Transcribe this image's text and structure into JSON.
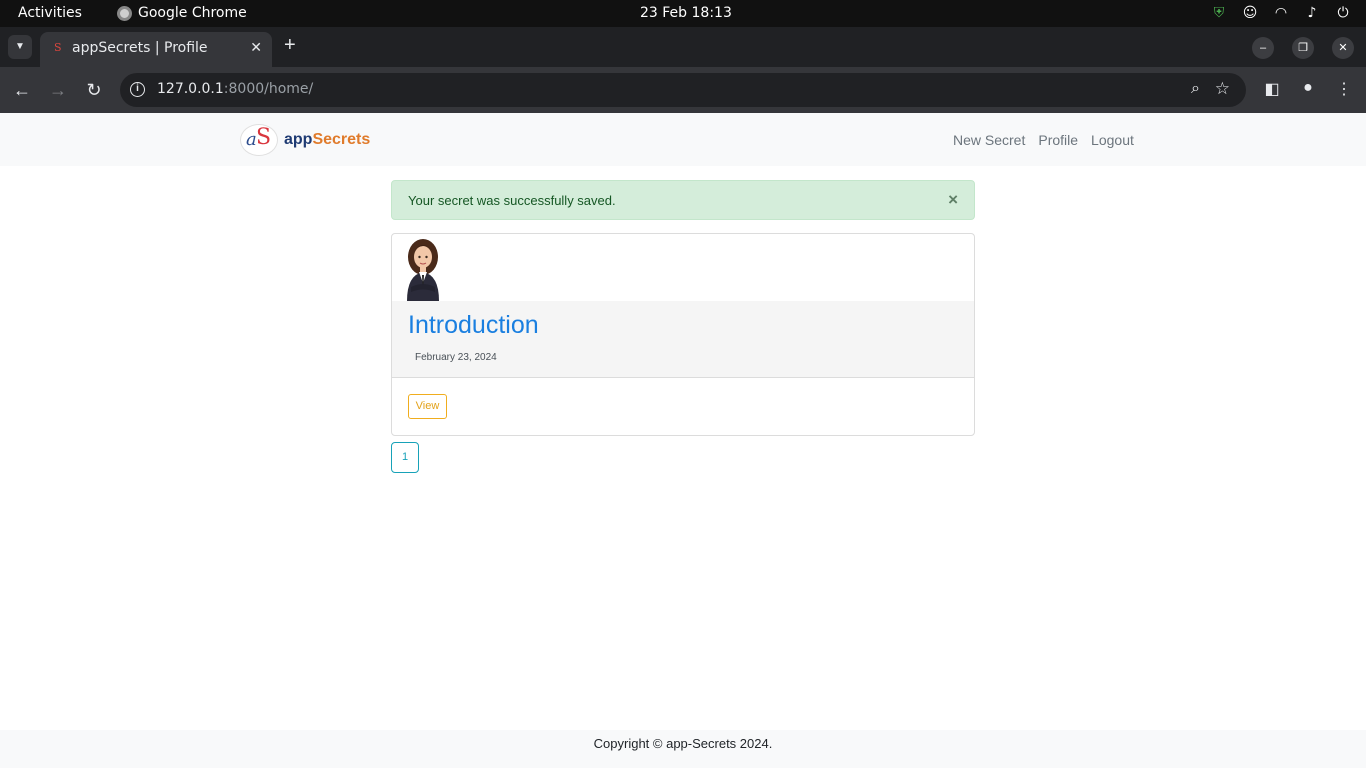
{
  "system_bar": {
    "activities": "Activities",
    "app_name": "Google Chrome",
    "clock": "23 Feb  18:13"
  },
  "browser": {
    "tab_title": "appSecrets | Profile",
    "url_host": "127.0.0.1",
    "url_rest": ":8000/home/"
  },
  "navbar": {
    "brand_app": "app",
    "brand_secrets": "Secrets",
    "links": [
      "New Secret",
      "Profile",
      "Logout"
    ]
  },
  "alert": {
    "message": "Your secret was successfully saved.",
    "close": "×"
  },
  "card": {
    "title": "Introduction",
    "date": "February 23, 2024",
    "view_label": "View"
  },
  "pagination": {
    "current": "1"
  },
  "footer": {
    "copyright": "Copyright © app-Secrets 2024."
  },
  "colors": {
    "alert_bg": "#d4edda",
    "title_blue": "#1a7fe0",
    "view_amber": "#f0ad1e",
    "pagination_teal": "#17a2b8"
  }
}
